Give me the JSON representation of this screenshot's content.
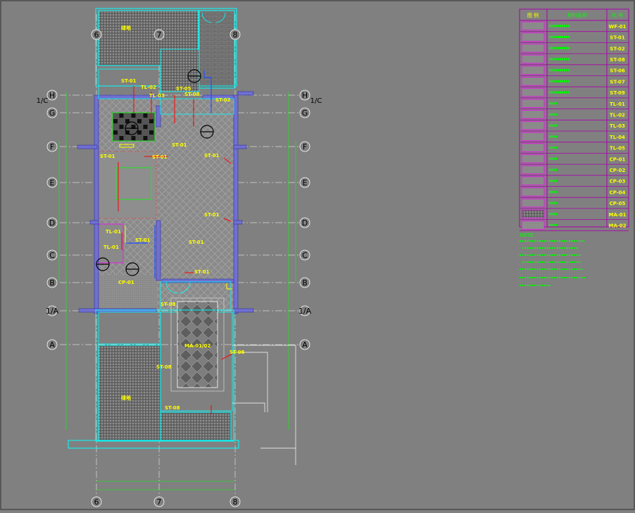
{
  "grid": {
    "rows_left": [
      "H",
      "1/C",
      "G",
      "F",
      "E",
      "D",
      "C",
      "B",
      "1/A",
      "A"
    ],
    "rows_right": [
      "H",
      "1/C",
      "G",
      "F",
      "E",
      "D",
      "C",
      "B",
      "1/A",
      "A"
    ],
    "cols_top": [
      "6",
      "7",
      "8"
    ],
    "cols_bottom": [
      "6",
      "7",
      "8"
    ]
  },
  "rooms": {
    "top_yard": "绿地",
    "bottom_yard": "绿地"
  },
  "callouts": {
    "st01": "ST-01",
    "st02": "ST-02",
    "st05": "ST-05",
    "st06": "ST-06",
    "st08": "ST-08",
    "tl01": "TL-01",
    "tl02": "TL-02",
    "tl03": "TL-03",
    "cp01": "CP-01",
    "ma0102": "MA-01/02"
  },
  "legend": {
    "header_left": "图 例",
    "header_mid": "材料名称",
    "header_right": "代 号",
    "codes": [
      "WF-01",
      "ST-01",
      "ST-02",
      "ST-08",
      "ST-06",
      "ST-07",
      "ST-09",
      "TL-01",
      "TL-02",
      "TL-03",
      "TL-04",
      "TL-05",
      "CP-01",
      "CP-02",
      "CP-03",
      "CP-04",
      "CP-05",
      "MA-01",
      "MA-02"
    ]
  },
  "notes": {
    "title": "NOTE:"
  },
  "colors": {
    "background": "#808080",
    "grid_line": "#ffffff",
    "wall": "#7070d0",
    "annotation": "#00ff00",
    "callout_text": "#ffff00",
    "leader": "#ff0000",
    "outline": "#00ffff",
    "legend_border": "#aa00aa"
  }
}
